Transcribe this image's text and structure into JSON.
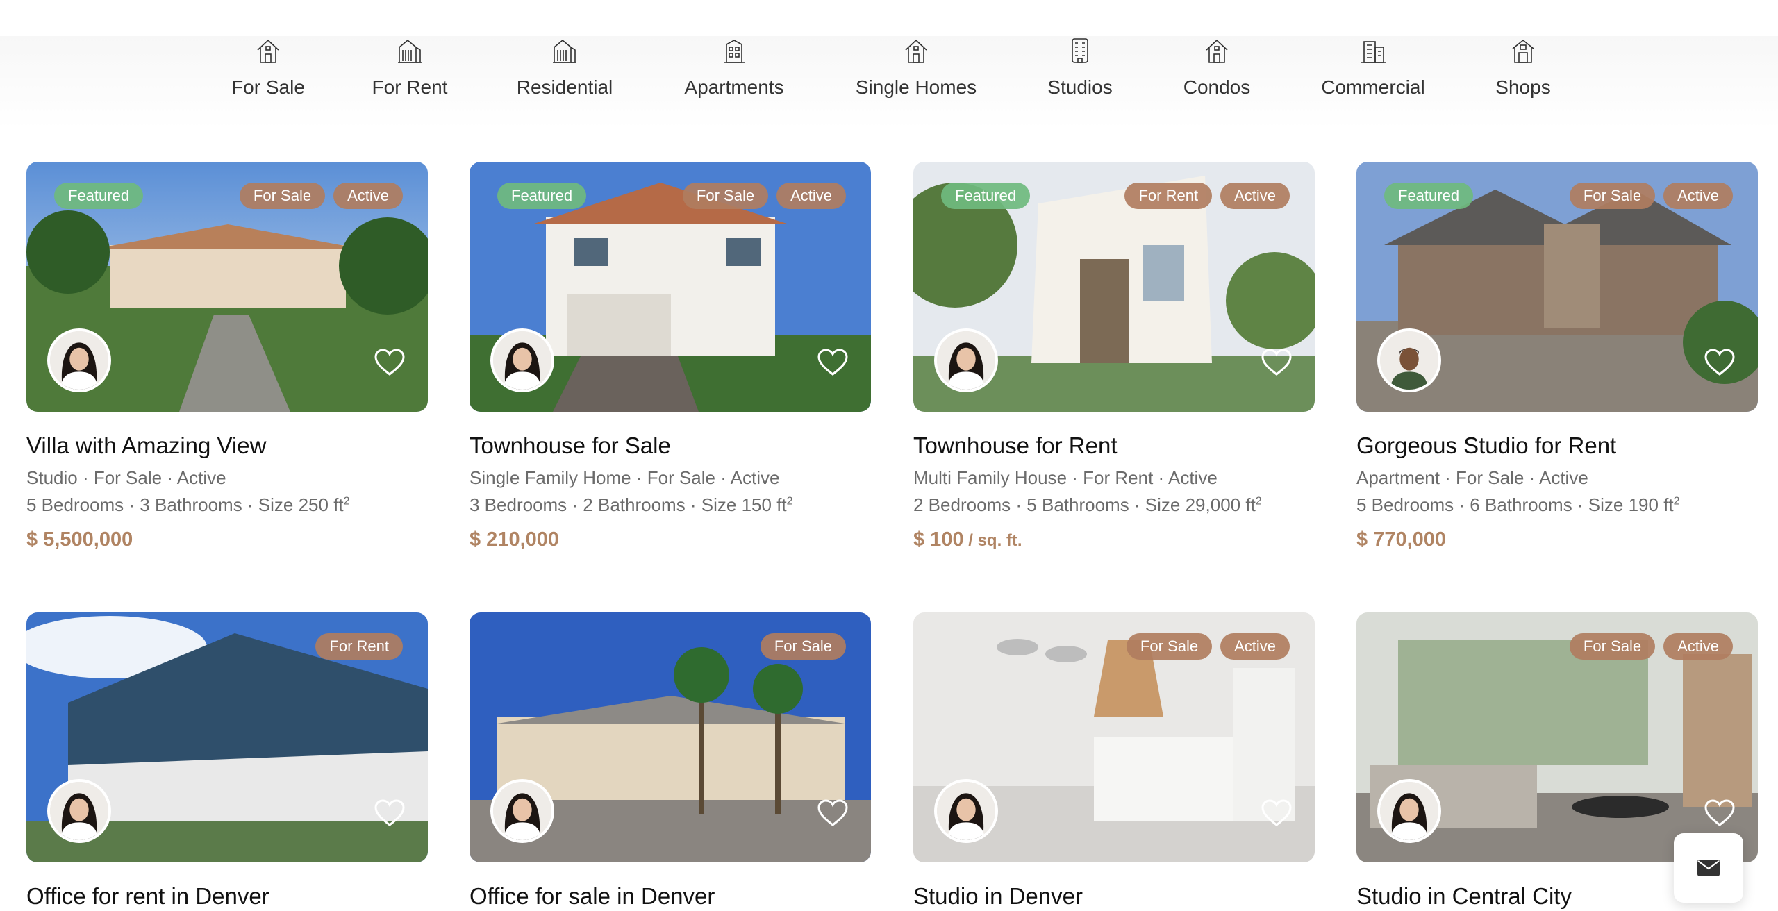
{
  "categories": [
    {
      "label": "For Sale",
      "icon": "house-icon"
    },
    {
      "label": "For Rent",
      "icon": "building-icon"
    },
    {
      "label": "Residential",
      "icon": "building-icon"
    },
    {
      "label": "Apartments",
      "icon": "apartment-icon"
    },
    {
      "label": "Single Homes",
      "icon": "house-icon"
    },
    {
      "label": "Studios",
      "icon": "tower-icon"
    },
    {
      "label": "Condos",
      "icon": "house-icon"
    },
    {
      "label": "Commercial",
      "icon": "office-icon"
    },
    {
      "label": "Shops",
      "icon": "shop-icon"
    }
  ],
  "listings": [
    {
      "title": "Villa with Amazing View",
      "featured": "Featured",
      "badges": [
        "For Sale",
        "Active"
      ],
      "meta": "Studio · For Sale · Active",
      "specs": "5 Bedrooms · 3 Bathrooms · Size 250 ft",
      "sup": "2",
      "price": "$ 5,500,000",
      "price_unit": ""
    },
    {
      "title": "Townhouse for Sale",
      "featured": "Featured",
      "badges": [
        "For Sale",
        "Active"
      ],
      "meta": "Single Family Home · For Sale · Active",
      "specs": "3 Bedrooms · 2 Bathrooms · Size 150 ft",
      "sup": "2",
      "price": "$ 210,000",
      "price_unit": ""
    },
    {
      "title": "Townhouse for Rent",
      "featured": "Featured",
      "badges": [
        "For Rent",
        "Active"
      ],
      "meta": "Multi Family House · For Rent · Active",
      "specs": "2 Bedrooms · 5 Bathrooms · Size 29,000 ft",
      "sup": "2",
      "price": "$ 100",
      "price_unit": " / sq. ft."
    },
    {
      "title": "Gorgeous Studio for Rent",
      "featured": "Featured",
      "badges": [
        "For Sale",
        "Active"
      ],
      "meta": "Apartment · For Sale · Active",
      "specs": "5 Bedrooms · 6 Bathrooms · Size 190 ft",
      "sup": "2",
      "price": "$ 770,000",
      "price_unit": ""
    },
    {
      "title": "Office for rent in Denver",
      "featured": "",
      "badges": [
        "For Rent"
      ],
      "meta": "",
      "specs": "",
      "sup": "",
      "price": "",
      "price_unit": ""
    },
    {
      "title": "Office for sale in Denver",
      "featured": "",
      "badges": [
        "For Sale"
      ],
      "meta": "",
      "specs": "",
      "sup": "",
      "price": "",
      "price_unit": ""
    },
    {
      "title": "Studio in Denver",
      "featured": "",
      "badges": [
        "For Sale",
        "Active"
      ],
      "meta": "",
      "specs": "",
      "sup": "",
      "price": "",
      "price_unit": ""
    },
    {
      "title": "Studio in Central City",
      "featured": "",
      "badges": [
        "For Sale",
        "Active"
      ],
      "meta": "",
      "specs": "",
      "sup": "",
      "price": "",
      "price_unit": ""
    }
  ],
  "colors": {
    "accent_price": "#b08463",
    "badge_featured": "#6fba7e",
    "badge_status": "#b07d5f"
  },
  "icons": {
    "favorite": "heart-icon",
    "contact": "envelope-icon",
    "agent": "avatar"
  }
}
